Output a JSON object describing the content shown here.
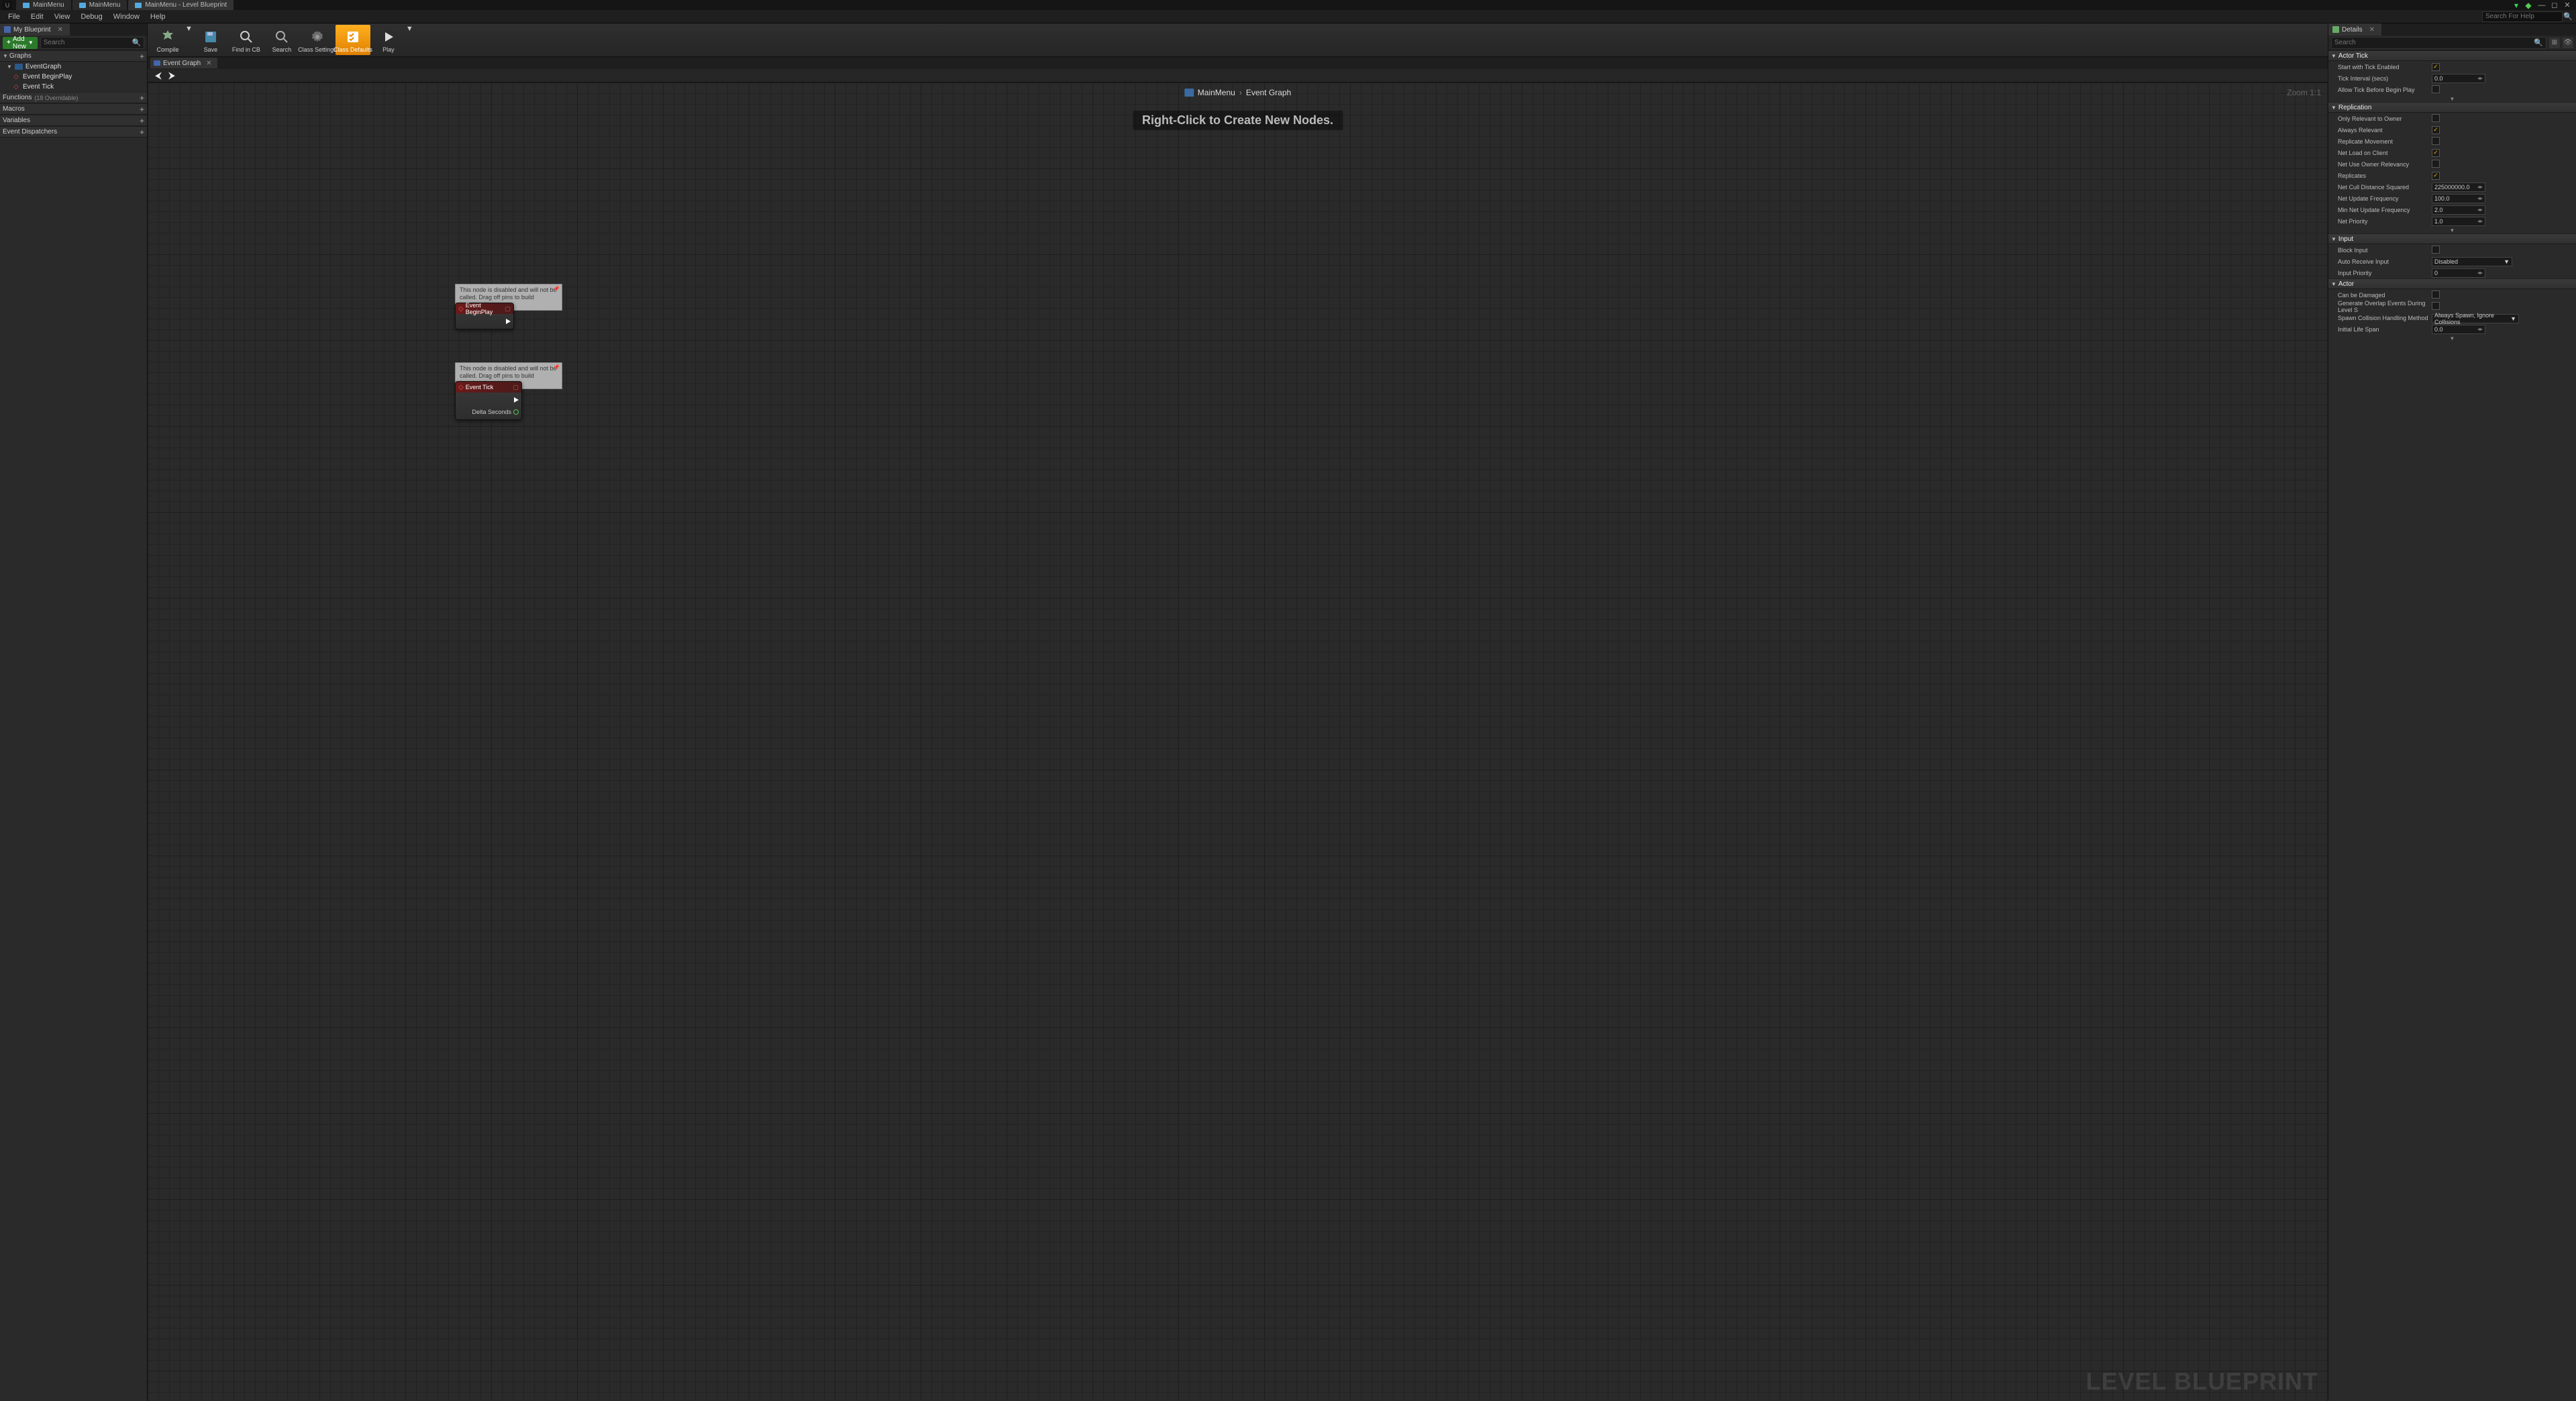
{
  "titlebar": {
    "tabs": [
      {
        "label": "MainMenu"
      },
      {
        "label": "MainMenu"
      },
      {
        "label": "MainMenu - Level Blueprint"
      }
    ]
  },
  "menubar": {
    "items": [
      "File",
      "Edit",
      "View",
      "Debug",
      "Window",
      "Help"
    ],
    "search_placeholder": "Search For Help"
  },
  "leftpanel": {
    "tab": "My Blueprint",
    "addnew": "Add New",
    "search_placeholder": "Search",
    "sections": {
      "graphs": {
        "label": "Graphs",
        "items": [
          {
            "label": "EventGraph",
            "kind": "graph"
          },
          {
            "label": "Event BeginPlay",
            "kind": "event"
          },
          {
            "label": "Event Tick",
            "kind": "event"
          }
        ]
      },
      "functions": {
        "label": "Functions",
        "extra": "(18 Overridable)"
      },
      "macros": {
        "label": "Macros"
      },
      "variables": {
        "label": "Variables"
      },
      "dispatchers": {
        "label": "Event Dispatchers"
      }
    }
  },
  "toolbar": {
    "compile": "Compile",
    "save": "Save",
    "findincb": "Find in CB",
    "search": "Search",
    "class_settings": "Class Settings",
    "class_defaults": "Class Defaults",
    "play": "Play"
  },
  "graph": {
    "tab": "Event Graph",
    "crumb_root": "MainMenu",
    "crumb_leaf": "Event Graph",
    "zoom": "Zoom 1:1",
    "hint": "Right-Click to Create New Nodes.",
    "watermark": "LEVEL BLUEPRINT",
    "tooltip": "This node is disabled and will not be called. Drag off pins to build functionality.",
    "node_beginplay": "Event BeginPlay",
    "node_tick": "Event Tick",
    "pin_delta": "Delta Seconds"
  },
  "details": {
    "tab": "Details",
    "search_placeholder": "Search",
    "cat_actortick": "Actor Tick",
    "start_tick": {
      "label": "Start with Tick Enabled",
      "checked": true
    },
    "tick_interval": {
      "label": "Tick Interval (secs)",
      "value": "0.0"
    },
    "allow_before": {
      "label": "Allow Tick Before Begin Play",
      "checked": false
    },
    "cat_replication": "Replication",
    "only_owner": {
      "label": "Only Relevant to Owner",
      "checked": false
    },
    "always_relevant": {
      "label": "Always Relevant",
      "checked": true
    },
    "rep_movement": {
      "label": "Replicate Movement",
      "checked": false
    },
    "net_load": {
      "label": "Net Load on Client",
      "checked": true
    },
    "net_use_owner": {
      "label": "Net Use Owner Relevancy",
      "checked": false
    },
    "replicates": {
      "label": "Replicates",
      "checked": true
    },
    "net_cull": {
      "label": "Net Cull Distance Squared",
      "value": "225000000.0"
    },
    "net_upd": {
      "label": "Net Update Frequency",
      "value": "100.0"
    },
    "min_net_upd": {
      "label": "Min Net Update Frequency",
      "value": "2.0"
    },
    "net_prio": {
      "label": "Net Priority",
      "value": "1.0"
    },
    "cat_input": "Input",
    "block_input": {
      "label": "Block Input",
      "checked": false
    },
    "auto_receive": {
      "label": "Auto Receive Input",
      "value": "Disabled"
    },
    "input_prio": {
      "label": "Input Priority",
      "value": "0"
    },
    "cat_actor": "Actor",
    "can_damaged": {
      "label": "Can be Damaged",
      "checked": false
    },
    "gen_overlap": {
      "label": "Generate Overlap Events During Level S",
      "checked": false
    },
    "spawn_coll": {
      "label": "Spawn Collision Handling Method",
      "value": "Always Spawn, Ignore Collisions"
    },
    "life_span": {
      "label": "Initial Life Span",
      "value": "0.0"
    }
  }
}
